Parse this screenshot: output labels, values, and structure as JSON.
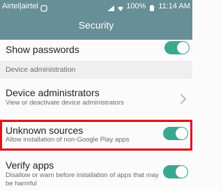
{
  "status": {
    "carrier": "Airtel|airtel",
    "battery": "100%",
    "time": "11:14 AM",
    "icons": [
      "signal-icon",
      "wifi-icon",
      "battery-icon",
      "notification-icon"
    ]
  },
  "header": {
    "title": "Security"
  },
  "rows": [
    {
      "title": "Show passwords",
      "subtitle": "",
      "control": "toggle",
      "checked": true
    },
    {
      "section_header": "Device administration"
    },
    {
      "title": "Device administrators",
      "subtitle": "View or deactivate device administrators",
      "control": "chevron"
    },
    {
      "title": "Unknown sources",
      "subtitle": "Allow installation of non-Google Play apps",
      "control": "toggle",
      "checked": true
    },
    {
      "title": "Verify apps",
      "subtitle": "Disallow or warn before installation of apps that may be harmful",
      "control": "toggle",
      "checked": true
    }
  ],
  "colors": {
    "topbar": "#678f97",
    "toggle_on": "#3aa78f",
    "highlight": "#e2121e"
  }
}
